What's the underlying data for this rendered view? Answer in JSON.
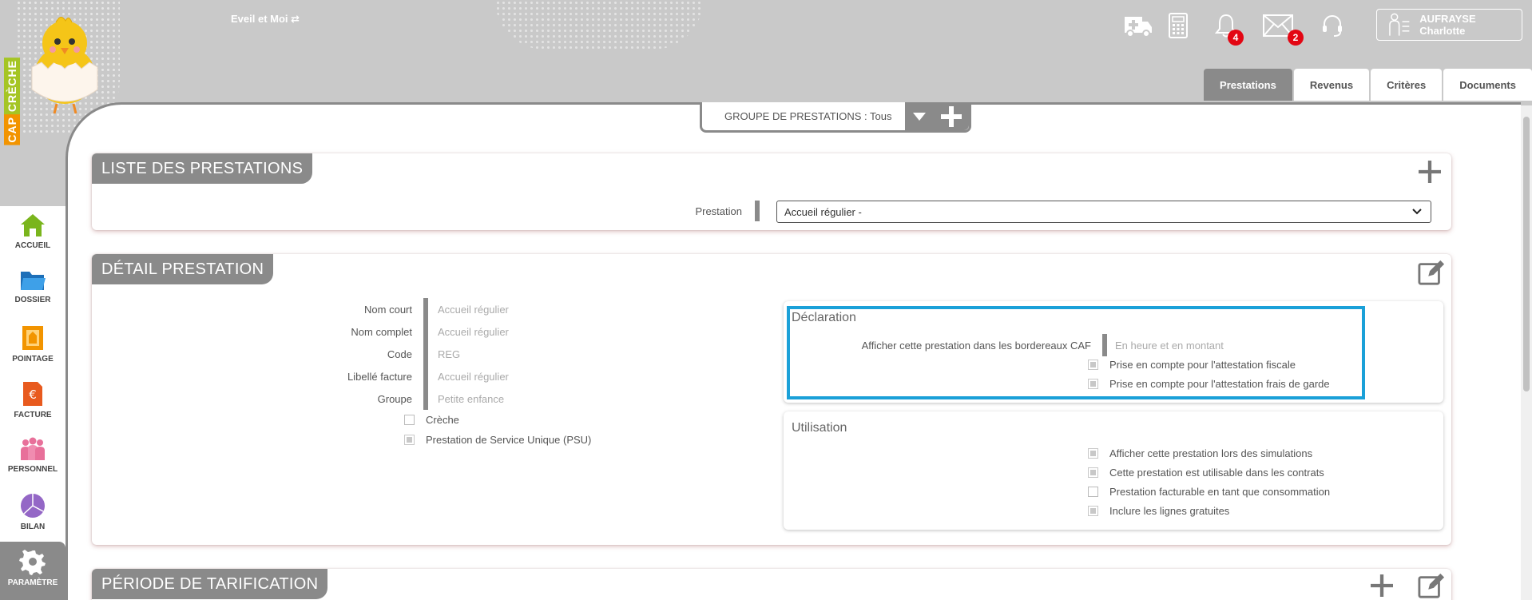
{
  "brand": {
    "cap": "CAP",
    "creche": "CRÈCHE"
  },
  "app": {
    "title": "Eveil et Moi"
  },
  "header": {
    "notifications_count": "4",
    "messages_count": "2",
    "user_name": "AUFRAYSE Charlotte"
  },
  "tabs": [
    {
      "label": "Prestations",
      "active": true
    },
    {
      "label": "Revenus",
      "active": false
    },
    {
      "label": "Critères",
      "active": false
    },
    {
      "label": "Documents",
      "active": false
    }
  ],
  "nav": [
    {
      "label": "ACCUEIL",
      "icon": "home-icon",
      "color": "#7ab51d"
    },
    {
      "label": "DOSSIER",
      "icon": "folder-icon",
      "color": "#2f8fd8"
    },
    {
      "label": "POINTAGE",
      "icon": "pointage-icon",
      "color": "#f29400"
    },
    {
      "label": "FACTURE",
      "icon": "invoice-icon",
      "color": "#e85a1e"
    },
    {
      "label": "PERSONNEL",
      "icon": "people-icon",
      "color": "#e8709a"
    },
    {
      "label": "BILAN",
      "icon": "chart-icon",
      "color": "#9467c6"
    },
    {
      "label": "PARAMÈTRE",
      "icon": "gear-icon",
      "color": "#ffffff"
    }
  ],
  "group_filter": {
    "label": "GROUPE DE PRESTATIONS : Tous"
  },
  "liste": {
    "title": "LISTE DES PRESTATIONS",
    "field_label": "Prestation",
    "selected": "Accueil régulier -"
  },
  "detail": {
    "title": "DÉTAIL PRESTATION",
    "fields": [
      {
        "label": "Nom court",
        "value": "Accueil régulier"
      },
      {
        "label": "Nom complet",
        "value": "Accueil régulier"
      },
      {
        "label": "Code",
        "value": "REG"
      },
      {
        "label": "Libellé facture",
        "value": "Accueil régulier"
      },
      {
        "label": "Groupe",
        "value": "Petite enfance"
      }
    ],
    "checks": [
      {
        "label": "Crèche",
        "checked": false
      },
      {
        "label": "Prestation de Service Unique (PSU)",
        "checked": true
      }
    ],
    "declaration": {
      "title": "Déclaration",
      "caf_label": "Afficher cette prestation dans les bordereaux CAF",
      "caf_value": "En heure et en montant",
      "checks": [
        {
          "label": "Prise en compte pour l'attestation fiscale",
          "checked": true
        },
        {
          "label": "Prise en compte pour l'attestation frais de garde",
          "checked": true
        }
      ]
    },
    "utilisation": {
      "title": "Utilisation",
      "checks": [
        {
          "label": "Afficher cette prestation lors des simulations",
          "checked": true
        },
        {
          "label": "Cette prestation est utilisable dans les contrats",
          "checked": true
        },
        {
          "label": "Prestation facturable en tant que consommation",
          "checked": false
        },
        {
          "label": "Inclure les lignes gratuites",
          "checked": true
        }
      ]
    }
  },
  "periode": {
    "title": "PÉRIODE DE TARIFICATION"
  },
  "colors": {
    "accent_gray": "#8a8a8a",
    "highlight": "#1aa0d8",
    "badge": "#e30613"
  }
}
